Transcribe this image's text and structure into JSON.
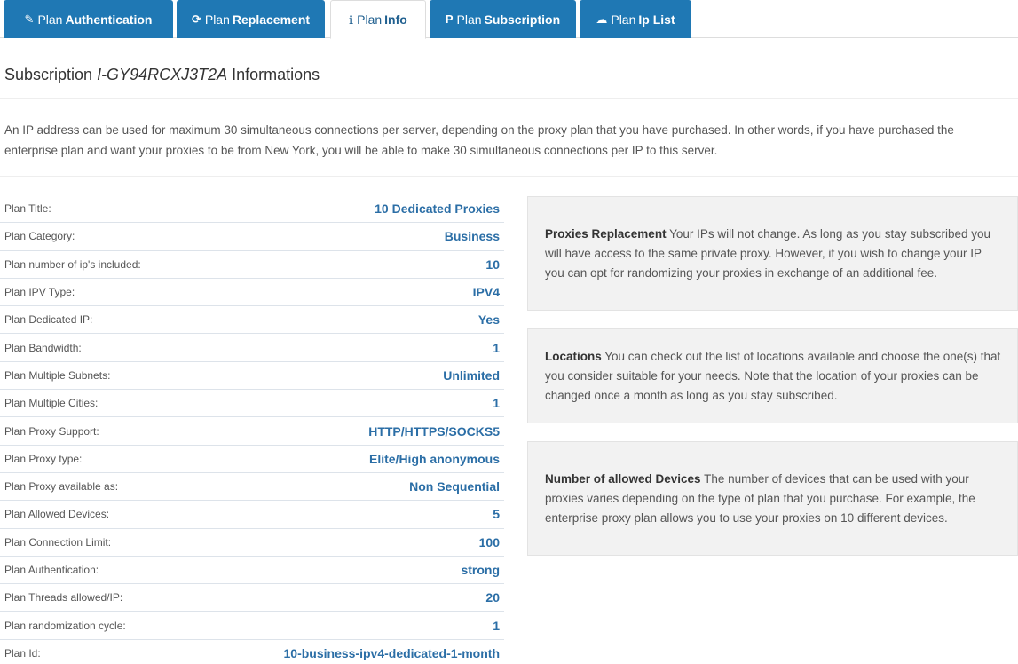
{
  "tabs": [
    {
      "icon": "wrench-icon",
      "glyph": "✎",
      "prefix": "Plan",
      "bold": "Authentication",
      "active": false
    },
    {
      "icon": "refresh-icon",
      "glyph": "⟳",
      "prefix": "Plan",
      "bold": "Replacement",
      "active": false
    },
    {
      "icon": "info-icon",
      "glyph": "ℹ",
      "prefix": "Plan",
      "bold": "Info",
      "active": true
    },
    {
      "icon": "paypal-icon",
      "glyph": "P",
      "prefix": "Plan",
      "bold": "Subscription",
      "active": false
    },
    {
      "icon": "cloud-upload-icon",
      "glyph": "☁",
      "prefix": "Plan",
      "bold": "Ip List",
      "active": false
    }
  ],
  "title": {
    "prefix": "Subscription ",
    "id": "I-GY94RCXJ3T2A",
    "suffix": " Informations"
  },
  "description": "An IP address can be used for maximum 30 simultaneous connections per server, depending on the proxy plan that you have purchased. In other words, if you have purchased the enterprise plan and want your proxies to be from New York, you will be able to make 30 simultaneous connections per IP to this server.",
  "plan_rows": [
    {
      "label": "Plan Title:",
      "value": "10 Dedicated Proxies"
    },
    {
      "label": "Plan Category:",
      "value": "Business"
    },
    {
      "label": "Plan number of ip's included:",
      "value": "10"
    },
    {
      "label": "Plan IPV Type:",
      "value": "IPV4"
    },
    {
      "label": "Plan Dedicated IP:",
      "value": "Yes"
    },
    {
      "label": "Plan Bandwidth:",
      "value": "1"
    },
    {
      "label": "Plan Multiple Subnets:",
      "value": "Unlimited"
    },
    {
      "label": "Plan Multiple Cities:",
      "value": "1"
    },
    {
      "label": "Plan Proxy Support:",
      "value": "HTTP/HTTPS/SOCKS5"
    },
    {
      "label": "Plan Proxy type:",
      "value": "Elite/High anonymous"
    },
    {
      "label": "Plan Proxy available as:",
      "value": "Non Sequential"
    },
    {
      "label": "Plan Allowed Devices:",
      "value": "5"
    },
    {
      "label": "Plan Connection Limit:",
      "value": "100"
    },
    {
      "label": "Plan Authentication:",
      "value": "strong"
    },
    {
      "label": "Plan Threads allowed/IP:",
      "value": "20"
    },
    {
      "label": "Plan randomization cycle:",
      "value": "1"
    },
    {
      "label": "Plan Id:",
      "value": "10-business-ipv4-dedicated-1-month"
    }
  ],
  "info_boxes": {
    "replacement": {
      "heading": "Proxies Replacement",
      "text": " Your IPs will not change. As long as you stay subscribed you will have access to the same private proxy. However, if you wish to change your IP you can opt for randomizing your proxies in exchange of an additional fee."
    },
    "locations": {
      "heading": "Locations",
      "text": " You can check out the list of locations available and choose the one(s) that you consider suitable for your needs. Note that the location of your proxies can be changed once a month as long as you stay subscribed."
    },
    "devices": {
      "heading": "Number of allowed Devices",
      "text": " The number of devices that can be used with your proxies varies depending on the type of plan that you purchase. For example, the enterprise proxy plan allows you to use your proxies on 10 different devices."
    }
  },
  "colors": {
    "tab_bg": "#1f78b4",
    "value_text": "#2b6ea6",
    "box_bg": "#f2f2f2"
  }
}
